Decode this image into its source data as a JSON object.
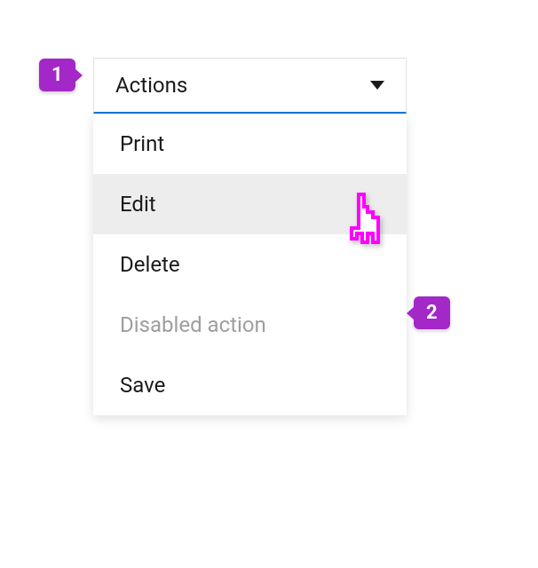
{
  "dropdown": {
    "trigger_label": "Actions",
    "items": [
      {
        "label": "Print",
        "state": "normal"
      },
      {
        "label": "Edit",
        "state": "hovered"
      },
      {
        "label": "Delete",
        "state": "normal"
      },
      {
        "label": "Disabled action",
        "state": "disabled"
      },
      {
        "label": "Save",
        "state": "normal"
      }
    ]
  },
  "callouts": {
    "one": "1",
    "two": "2"
  },
  "colors": {
    "accent": "#0078d4",
    "callout": "#a328c7",
    "cursor_outline": "#ff00ff"
  }
}
